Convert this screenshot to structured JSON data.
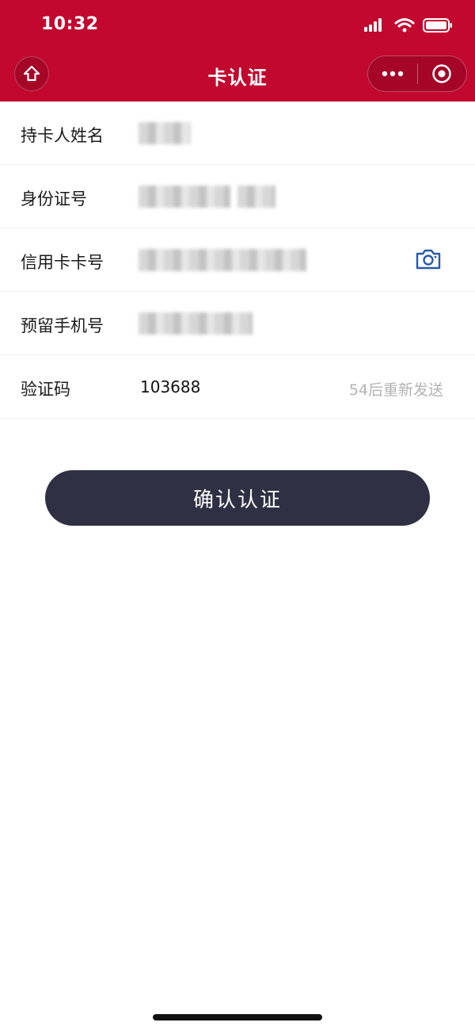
{
  "status_bar": {
    "time": "10:32"
  },
  "nav": {
    "title": "卡认证",
    "icons": {
      "home": "home-icon",
      "more": "more-dots-icon",
      "close": "target-circle-icon"
    }
  },
  "form": {
    "rows": [
      {
        "label": "持卡人姓名",
        "value": ""
      },
      {
        "label": "身份证号",
        "value": ""
      },
      {
        "label": "信用卡卡号",
        "value": "",
        "icon": "camera-icon"
      },
      {
        "label": "预留手机号",
        "value": ""
      },
      {
        "label": "验证码",
        "value": "103688",
        "resend": "54后重新发送"
      }
    ]
  },
  "actions": {
    "confirm_label": "确认认证"
  },
  "colors": {
    "header": "#c2082f",
    "button": "#2f3043",
    "camera_icon": "#2a5aa8"
  }
}
